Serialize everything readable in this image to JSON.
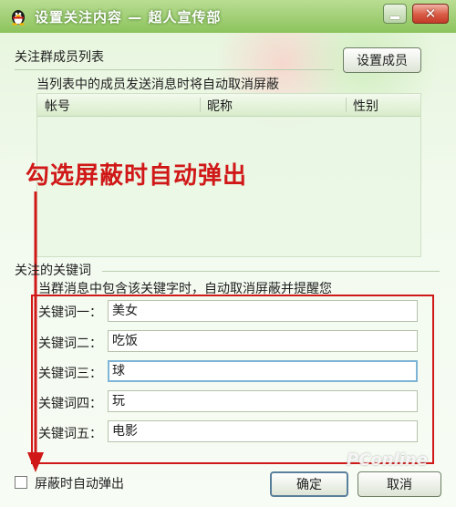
{
  "window": {
    "title": "设置关注内容 — 超人宣传部",
    "close_symbol": "✕"
  },
  "members": {
    "section_title": "关注群成员列表",
    "set_button": "设置成员",
    "hint": "当列表中的成员发送消息时将自动取消屏蔽",
    "columns": [
      "帐号",
      "昵称",
      "性别"
    ]
  },
  "annotation": {
    "text": "勾选屏蔽时自动弹出",
    "color": "#d01818"
  },
  "keywords": {
    "section_title": "关注的关键词",
    "hint": "当群消息中包含该关键字时，自动取消屏蔽并提醒您",
    "items": [
      {
        "label": "关键词一：",
        "value": "美女"
      },
      {
        "label": "关键词二：",
        "value": "吃饭"
      },
      {
        "label": "关键词三：",
        "value": "球"
      },
      {
        "label": "关键词四：",
        "value": "玩"
      },
      {
        "label": "关键词五：",
        "value": "电影"
      }
    ]
  },
  "footer": {
    "checkbox_label": "屏蔽时自动弹出",
    "ok_button": "确定",
    "cancel_button": "取消"
  },
  "watermark": "PConline",
  "colors": {
    "titlebar": "#8cc35c",
    "accent_red": "#d01818"
  },
  "icons": {
    "app": "qq-penguin-icon",
    "minimize": "minimize-icon",
    "close": "close-icon"
  }
}
